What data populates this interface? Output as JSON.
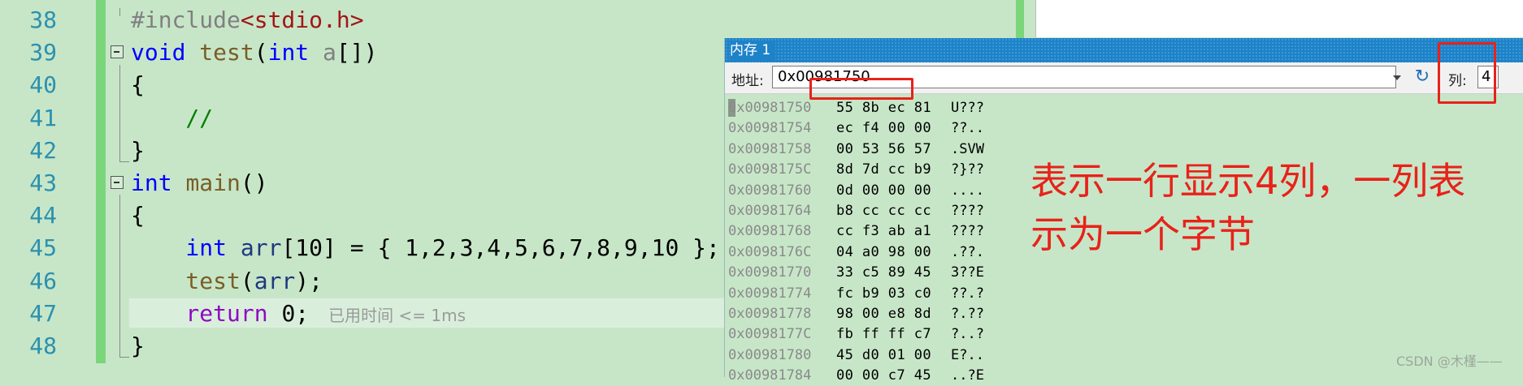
{
  "editor": {
    "lines": [
      {
        "num": "38",
        "parts": [
          {
            "c": "pp",
            "t": "#include"
          },
          {
            "c": "str",
            "t": "<stdio.h>"
          }
        ]
      },
      {
        "num": "39",
        "parts": [
          {
            "c": "kw",
            "t": "void "
          },
          {
            "c": "ty",
            "t": "test"
          },
          {
            "c": "",
            "t": "("
          },
          {
            "c": "kw",
            "t": "int "
          },
          {
            "c": "pr",
            "t": "a"
          },
          {
            "c": "",
            "t": "[])"
          }
        ]
      },
      {
        "num": "40",
        "parts": [
          {
            "c": "",
            "t": "{"
          }
        ]
      },
      {
        "num": "41",
        "parts": [
          {
            "c": "cm",
            "t": "    //"
          }
        ]
      },
      {
        "num": "42",
        "parts": [
          {
            "c": "",
            "t": "}"
          }
        ]
      },
      {
        "num": "43",
        "parts": [
          {
            "c": "kw",
            "t": "int "
          },
          {
            "c": "ty",
            "t": "main"
          },
          {
            "c": "",
            "t": "()"
          }
        ]
      },
      {
        "num": "44",
        "parts": [
          {
            "c": "",
            "t": "{"
          }
        ]
      },
      {
        "num": "45",
        "parts": [
          {
            "c": "kw",
            "t": "    int "
          },
          {
            "c": "id",
            "t": "arr"
          },
          {
            "c": "",
            "t": "[10] = { 1,2,3,4,5,6,7,8,9,10 };"
          }
        ]
      },
      {
        "num": "46",
        "parts": [
          {
            "c": "ty",
            "t": "    test"
          },
          {
            "c": "",
            "t": "("
          },
          {
            "c": "id",
            "t": "arr"
          },
          {
            "c": "",
            "t": ");"
          }
        ]
      },
      {
        "num": "47",
        "parts": [
          {
            "c": "ret",
            "t": "    return "
          },
          {
            "c": "",
            "t": "0;"
          }
        ]
      },
      {
        "num": "48",
        "parts": [
          {
            "c": "",
            "t": "}"
          }
        ]
      }
    ],
    "perf_tip": "已用时间 <= 1ms"
  },
  "memory": {
    "title": "内存 1",
    "address_label": "地址:",
    "address_value": "0x00981750",
    "columns_label": "列:",
    "columns_value": "4",
    "rows": [
      {
        "addr": "0x00981750",
        "bytes": "55 8b ec 81",
        "ascii": "U???"
      },
      {
        "addr": "0x00981754",
        "bytes": "ec f4 00 00",
        "ascii": "??.."
      },
      {
        "addr": "0x00981758",
        "bytes": "00 53 56 57",
        "ascii": ".SVW"
      },
      {
        "addr": "0x0098175C",
        "bytes": "8d 7d cc b9",
        "ascii": "?}??"
      },
      {
        "addr": "0x00981760",
        "bytes": "0d 00 00 00",
        "ascii": "...."
      },
      {
        "addr": "0x00981764",
        "bytes": "b8 cc cc cc",
        "ascii": "????"
      },
      {
        "addr": "0x00981768",
        "bytes": "cc f3 ab a1",
        "ascii": "????"
      },
      {
        "addr": "0x0098176C",
        "bytes": "04 a0 98 00",
        "ascii": ".??."
      },
      {
        "addr": "0x00981770",
        "bytes": "33 c5 89 45",
        "ascii": "3??E"
      },
      {
        "addr": "0x00981774",
        "bytes": "fc b9 03 c0",
        "ascii": "??.?"
      },
      {
        "addr": "0x00981778",
        "bytes": "98 00 e8 8d",
        "ascii": "?.??"
      },
      {
        "addr": "0x0098177C",
        "bytes": "fb ff ff c7",
        "ascii": "?..?"
      },
      {
        "addr": "0x00981780",
        "bytes": "45 d0 01 00",
        "ascii": "E?.."
      },
      {
        "addr": "0x00981784",
        "bytes": "00 00 c7 45",
        "ascii": "..?E"
      }
    ]
  },
  "annotation": {
    "line1": "表示一行显示4列，一列表",
    "line2": "示为一个字节"
  },
  "watermark": "CSDN @木槿——"
}
